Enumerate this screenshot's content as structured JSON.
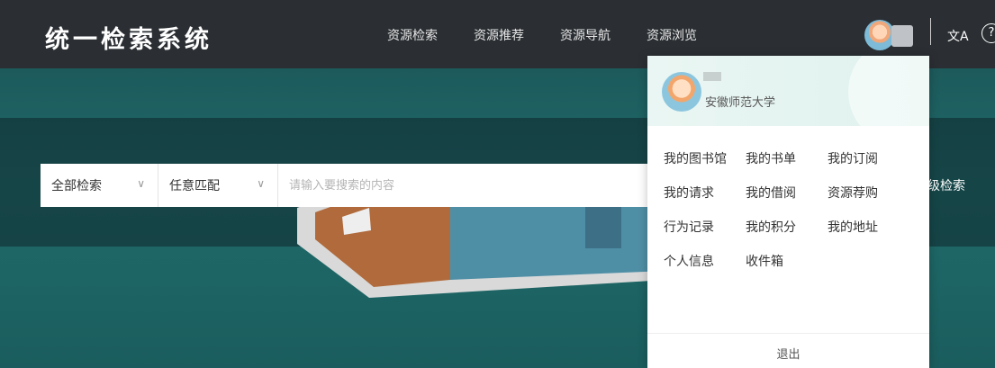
{
  "header": {
    "brand": "统一检索系统",
    "nav": [
      "资源检索",
      "资源推荐",
      "资源导航",
      "资源浏览"
    ],
    "translate_icon": "translate-icon",
    "help_icon": "help-icon"
  },
  "search": {
    "scope": "全部检索",
    "match": "任意匹配",
    "placeholder": "请输入要搜索的内容",
    "advanced": "级检索"
  },
  "user_panel": {
    "school": "安徽师范大学",
    "menu": [
      "我的图书馆",
      "我的书单",
      "我的订阅",
      "我的请求",
      "我的借阅",
      "资源荐购",
      "行为记录",
      "我的积分",
      "我的地址",
      "个人信息",
      "收件箱"
    ],
    "logout": "退出"
  }
}
